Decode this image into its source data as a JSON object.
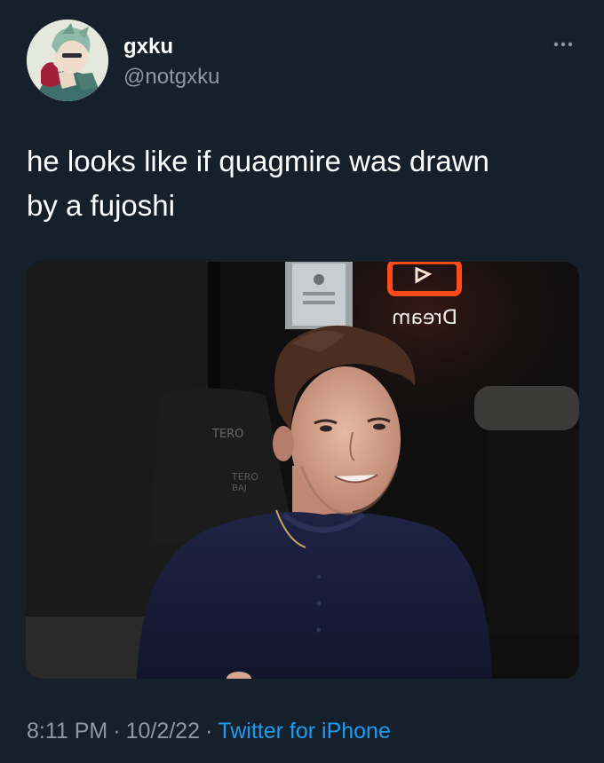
{
  "author": {
    "display_name": "gxku",
    "handle": "@notgxku",
    "avatar_icon": "anime-character-avatar"
  },
  "more_menu": {
    "icon": "more-horizontal-icon"
  },
  "tweet": {
    "text": "he looks like if quagmire was drawn\nby a fujoshi"
  },
  "media": {
    "neon_sign_text": "Dream",
    "chair_text_upper": "TERO",
    "chair_text_lower": "TERO",
    "chair_text_small": "BAJ"
  },
  "footer": {
    "time": "8:11 PM",
    "date": "10/2/22",
    "separator": "·",
    "source": "Twitter for iPhone"
  },
  "colors": {
    "background": "#15202b",
    "text_primary": "#ffffff",
    "text_secondary": "#8b98a5",
    "link": "#1d9bf0",
    "neon_orange": "#ff4a1c"
  }
}
